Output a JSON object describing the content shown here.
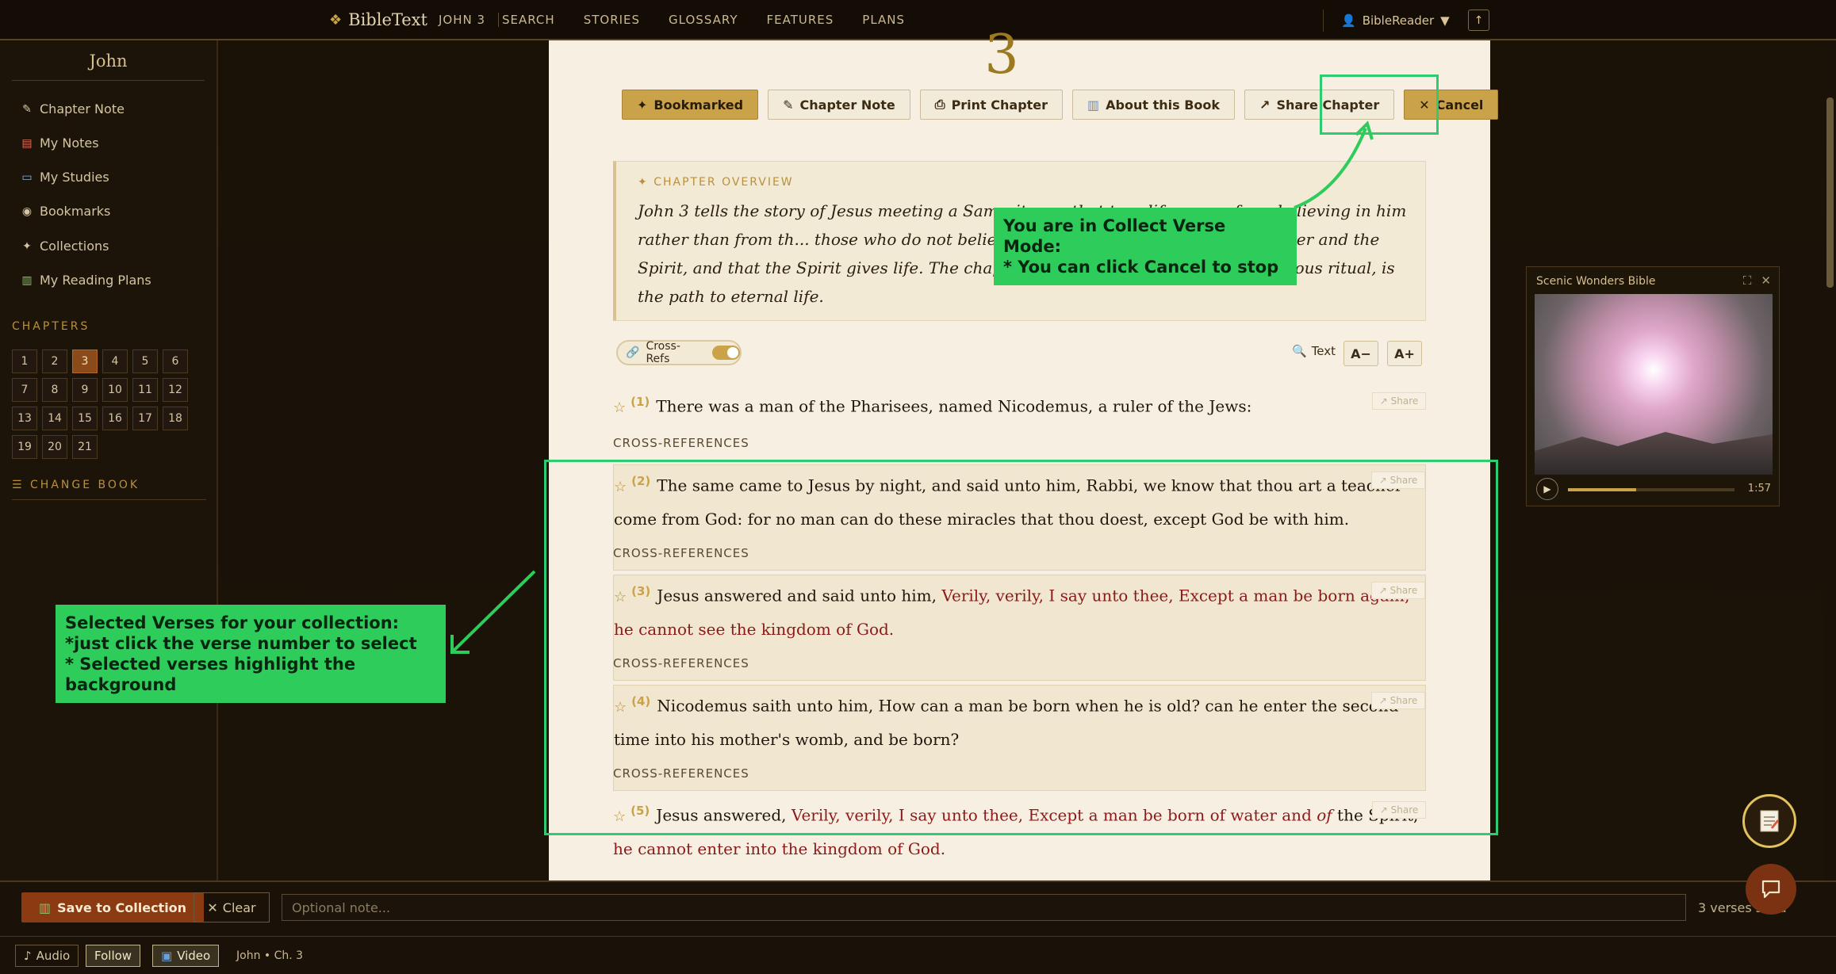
{
  "topbar": {
    "brand": "BibleText",
    "reference": "JOHN 3",
    "links": [
      "SEARCH",
      "STORIES",
      "GLOSSARY",
      "FEATURES",
      "PLANS"
    ],
    "user": "BibleReader",
    "up_label": "↑"
  },
  "sidebar": {
    "book": "John",
    "items": [
      "Chapter Note",
      "My Notes",
      "My Studies",
      "Bookmarks",
      "Collections",
      "My Reading Plans"
    ],
    "chapters_label": "CHAPTERS",
    "chapters": [
      "1",
      "2",
      "3",
      "4",
      "5",
      "6",
      "7",
      "8",
      "9",
      "10",
      "11",
      "12",
      "13",
      "14",
      "15",
      "16",
      "17",
      "18",
      "19",
      "20",
      "21"
    ],
    "active_chapter": "3",
    "change_book": "CHANGE BOOK"
  },
  "main": {
    "chapter_number": "3",
    "actions": [
      "Bookmarked",
      "Chapter Note",
      "Print Chapter",
      "About this Book",
      "Share Chapter",
      "Cancel"
    ],
    "overview_label": "CHAPTER OVERVIEW",
    "overview_text": "John 3 tells the story of Jesus meeting a Samaritan ... that true life comes from believing in him rather than from th... those who do not believe are like those who are born of water and the Spirit, and that the Spirit gives life. The chapter emphasizes that belief, not religious ritual, is the path to eternal life.",
    "crossrefs_toggle": "Cross-Refs",
    "text_label": "Text",
    "font_minus": "A−",
    "font_plus": "A+",
    "share_label": "↗ Share",
    "xref_label": "CROSS-REFERENCES",
    "verses": [
      {
        "num": "(1)",
        "plain": "There was a man of the Pharisees, named Nicodemus, a ruler of the Jews:",
        "red": ""
      },
      {
        "num": "(2)",
        "plain": "The same came to Jesus by night, and said unto him, Rabbi, we know that thou art a teacher come from God: for no man can do these miracles that thou doest, except God be with him.",
        "red": ""
      },
      {
        "num": "(3)",
        "plain": "Jesus answered and said unto him,",
        "red": "Verily, verily, I say unto thee, Except a man be born again, he cannot see the kingdom of God."
      },
      {
        "num": "(4)",
        "plain": "Nicodemus saith unto him, How can a man be born when he is old? can he enter the second time into his mother's womb, and be born?",
        "red": ""
      },
      {
        "num": "(5)",
        "plain": "Jesus answered,",
        "red": "Verily, verily, I say unto thee, Except a man be born of water and",
        "italic": "of",
        "plain2": "the Spirit,",
        "red2": "he cannot enter into the kingdom of God."
      }
    ]
  },
  "annotations": {
    "collect_mode": "You are in Collect Verse Mode:\n* You can click Cancel to stop",
    "selected_verses": "Selected Verses for your collection:\n*just click the verse number to select\n* Selected verses highlight the background"
  },
  "video": {
    "title": "Scenic Wonders Bible",
    "time": "1:57",
    "progress": 0.41
  },
  "collect_bar": {
    "save_label": "Save to Collection",
    "clear_label": "Clear",
    "note_placeholder": "Optional note...",
    "count_label": "3 verses s... d"
  },
  "media_bar": {
    "audio": "Audio",
    "follow": "Follow",
    "video": "Video",
    "crumb": "John • Ch. 3"
  },
  "colors": {
    "accent": "#c9a24a",
    "annotation": "#2ecc5a",
    "words_of_christ": "#8a1a1a"
  }
}
